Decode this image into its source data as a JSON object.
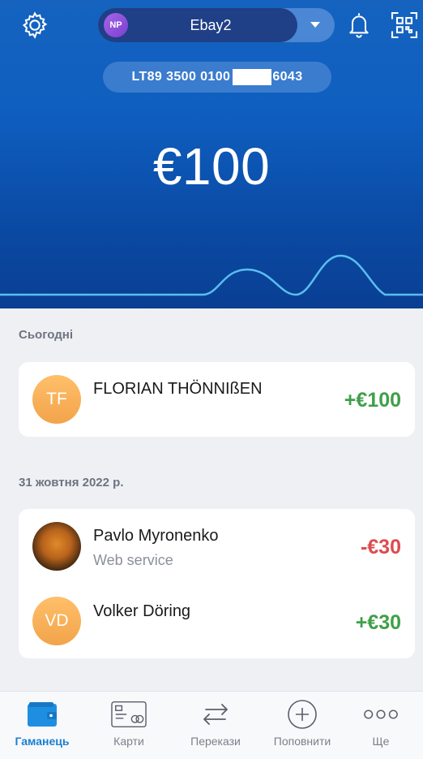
{
  "header": {
    "account": {
      "initials": "NP",
      "name": "Ebay2"
    },
    "iban": {
      "prefix": "LT89 3500 0100",
      "suffix": "6043"
    },
    "balance": "€100"
  },
  "sections": [
    {
      "label": "Сьогодні",
      "transactions": [
        {
          "initials": "TF",
          "name": "FLORIAN THÖNNIßEN",
          "amount": "+€100"
        }
      ]
    },
    {
      "label": "31 жовтня 2022 р.",
      "transactions": [
        {
          "initials": "",
          "name": "Pavlo Myronenko",
          "subtitle": "Web service",
          "amount": "-€30"
        },
        {
          "initials": "VD",
          "name": "Volker Döring",
          "amount": "+€30"
        }
      ]
    }
  ],
  "tabbar": [
    {
      "label": "Гаманець",
      "icon": "wallet-icon",
      "active": true
    },
    {
      "label": "Карти",
      "icon": "cards-icon"
    },
    {
      "label": "Перекази",
      "icon": "transfer-arrows-icon"
    },
    {
      "label": "Поповнити",
      "icon": "plus-circle-icon"
    },
    {
      "label": "Ще",
      "icon": "more-dots-icon"
    }
  ],
  "colors": {
    "header_blue": "#0f5fc0",
    "positive": "#3ea048",
    "negative": "#dd4b4e",
    "tab_active": "#1a7fd0"
  }
}
